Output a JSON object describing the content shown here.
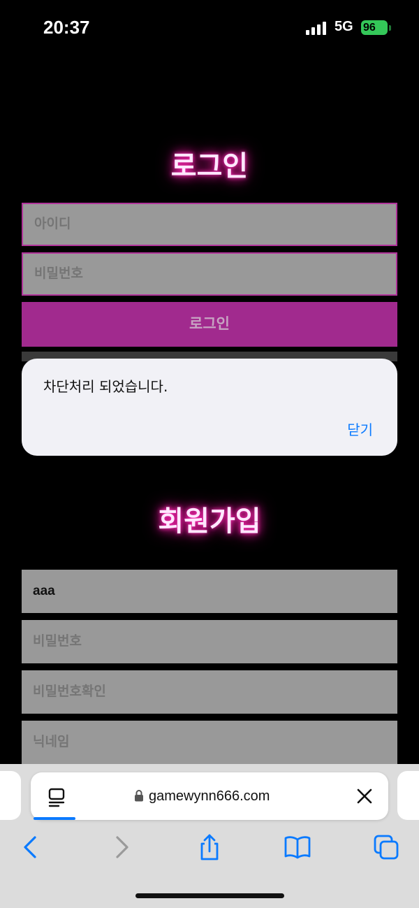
{
  "status_bar": {
    "time": "20:37",
    "network": "5G",
    "battery": "96"
  },
  "login": {
    "title": "로그인",
    "id_placeholder": "아이디",
    "pw_placeholder": "비밀번호",
    "button_label": "로그인"
  },
  "alert": {
    "message": "차단처리 되었습니다.",
    "close_label": "닫기"
  },
  "signup": {
    "title": "회원가입",
    "id_value": "aaa",
    "pw_placeholder": "비밀번호",
    "pw_confirm_placeholder": "비밀번호확인",
    "nickname_placeholder": "닉네임"
  },
  "browser": {
    "url": "gamewynn666.com"
  },
  "colors": {
    "accent_pink": "#a12a8e",
    "ios_blue": "#0a7aff",
    "battery_green": "#34c759"
  }
}
